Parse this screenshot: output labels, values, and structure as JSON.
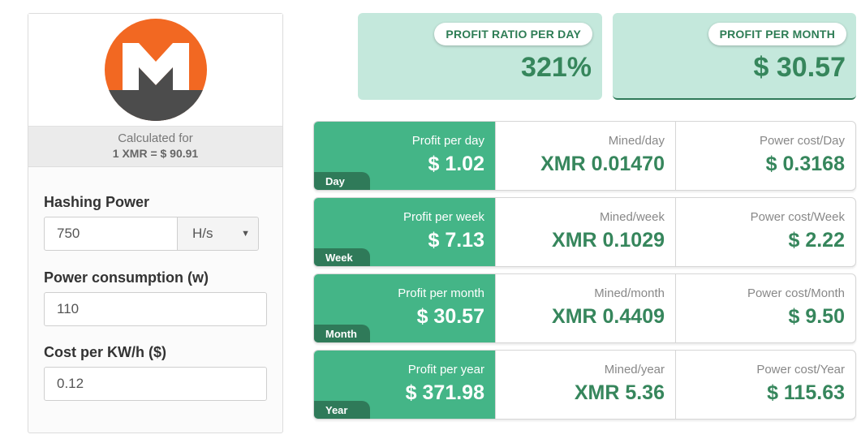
{
  "logo": {
    "name": "monero-logo",
    "colors": {
      "orange": "#f26822",
      "gray": "#4c4c4c"
    }
  },
  "rate": {
    "line1": "Calculated for",
    "line2": "1 XMR = $ 90.91"
  },
  "form": {
    "hashing_label": "Hashing Power",
    "hashing_value": "750",
    "hashing_unit": "H/s",
    "power_label": "Power consumption (w)",
    "power_value": "110",
    "cost_label": "Cost per KW/h ($)",
    "cost_value": "0.12"
  },
  "summary": [
    {
      "label": "PROFIT RATIO PER DAY",
      "value": "321%"
    },
    {
      "label": "PROFIT PER MONTH",
      "value": "$ 30.57"
    }
  ],
  "rows": [
    {
      "tab": "Day",
      "profit_label": "Profit per day",
      "profit": "$ 1.02",
      "mined_label": "Mined/day",
      "mined": "XMR 0.01470",
      "power_label": "Power cost/Day",
      "power": "$ 0.3168"
    },
    {
      "tab": "Week",
      "profit_label": "Profit per week",
      "profit": "$ 7.13",
      "mined_label": "Mined/week",
      "mined": "XMR 0.1029",
      "power_label": "Power cost/Week",
      "power": "$ 2.22"
    },
    {
      "tab": "Month",
      "profit_label": "Profit per month",
      "profit": "$ 30.57",
      "mined_label": "Mined/month",
      "mined": "XMR 0.4409",
      "power_label": "Power cost/Month",
      "power": "$ 9.50"
    },
    {
      "tab": "Year",
      "profit_label": "Profit per year",
      "profit": "$ 371.98",
      "mined_label": "Mined/year",
      "mined": "XMR 5.36",
      "power_label": "Power cost/Year",
      "power": "$ 115.63"
    }
  ],
  "colors": {
    "accent_green": "#44b587",
    "dark_green": "#2f7a59",
    "mint": "#c4e8dc"
  }
}
